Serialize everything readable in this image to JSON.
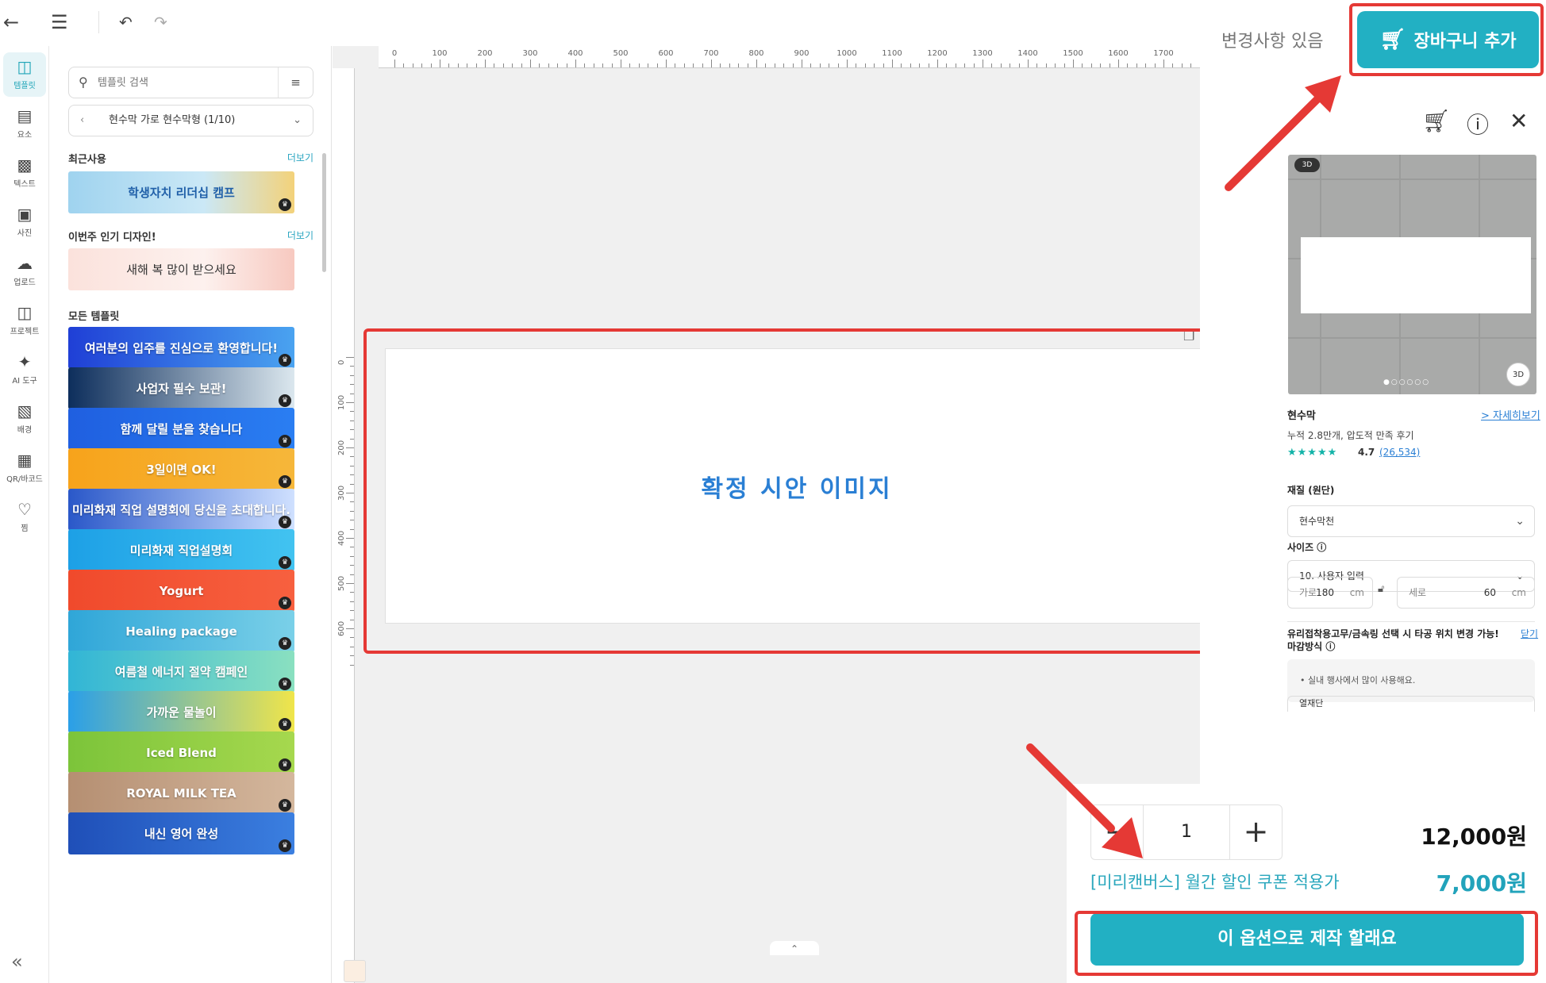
{
  "topbar": {
    "back_icon": "arrow-left-icon",
    "menu_icon": "menu-icon",
    "undo_icon": "undo-icon",
    "redo_icon": "redo-icon"
  },
  "rail": {
    "items": [
      {
        "label": "템플릿",
        "icon": "template-icon",
        "active": true
      },
      {
        "label": "요소",
        "icon": "shapes-icon"
      },
      {
        "label": "텍스트",
        "icon": "text-icon"
      },
      {
        "label": "사진",
        "icon": "photo-icon"
      },
      {
        "label": "업로드",
        "icon": "upload-cloud-icon"
      },
      {
        "label": "프로젝트",
        "icon": "archive-icon"
      },
      {
        "label": "AI 도구",
        "icon": "ai-sparkle-icon"
      },
      {
        "label": "배경",
        "icon": "pattern-icon"
      },
      {
        "label": "QR/바코드",
        "icon": "qr-icon"
      },
      {
        "label": "찜",
        "icon": "heart-icon"
      }
    ],
    "collapse_icon": "double-chevron-left-icon"
  },
  "panel": {
    "search_placeholder": "템플릿 검색",
    "category": "현수막 가로 현수막형 (1/10)",
    "recent_title": "최근사용",
    "popular_title": "이번주 인기 디자인!",
    "all_title": "모든 템플릿",
    "more_label": "더보기",
    "recent_template": "학생자치 리더십 캠프",
    "popular_template": "새해 복 많이 받으세요",
    "templates": [
      {
        "text": "여러분의 입주를 진심으로 환영합니다!",
        "bg": "linear-gradient(90deg,#1f3fd6,#4aa3f0)"
      },
      {
        "text": "사업자 필수 보관!",
        "bg": "linear-gradient(90deg,#0d2e5c,#dbe7ee)"
      },
      {
        "text": "함께 달릴 분을 찾습니다",
        "bg": "linear-gradient(90deg,#1f5fe0,#2a7ef2)"
      },
      {
        "text": "3일이면 OK!",
        "bg": "linear-gradient(90deg,#f7a31b,#f6b73a)"
      },
      {
        "text": "미리화재 직업 설명회에 당신을 초대합니다.",
        "bg": "linear-gradient(90deg,#2a58c9,#cfe0ff)"
      },
      {
        "text": "미리화재 직업설명회",
        "bg": "linear-gradient(90deg,#1da0e6,#42c3f0)"
      },
      {
        "text": "Yogurt",
        "bg": "linear-gradient(90deg,#f04a2c,#f7603f)"
      },
      {
        "text": "Healing package",
        "bg": "linear-gradient(90deg,#2fa6d8,#7ad0e8)"
      },
      {
        "text": "여름철 에너지 절약 캠페인",
        "bg": "linear-gradient(90deg,#31b5d6,#8ae0c0)"
      },
      {
        "text": "가까운 물놀이",
        "bg": "linear-gradient(90deg,#2a9fe8,#f0e54a)"
      },
      {
        "text": "Iced Blend",
        "bg": "linear-gradient(90deg,#7cc43a,#a6d84e)"
      },
      {
        "text": "ROYAL MILK TEA",
        "bg": "linear-gradient(90deg,#b58f72,#d4b79d)"
      },
      {
        "text": "내신 영어 완성",
        "bg": "linear-gradient(90deg,#1f4fb8,#3b7fe0)"
      }
    ]
  },
  "canvas": {
    "ruler_h": [
      "0",
      "100",
      "200",
      "300",
      "400",
      "500",
      "600",
      "700",
      "800",
      "900",
      "1000",
      "1100",
      "1200",
      "1300",
      "1400",
      "1500",
      "1600",
      "1700"
    ],
    "ruler_v": [
      "0",
      "100",
      "200",
      "300",
      "400",
      "500",
      "600"
    ],
    "preview_label": "확정 시안 이미지",
    "copy_icon": "copy-page-icon",
    "collapse_icon": "chevron-up-icon"
  },
  "right_header": {
    "changes_label": "변경사항 있음",
    "cart_button": "장바구니 추가",
    "cart_icon": "cart-icon"
  },
  "product": {
    "icons": [
      "cart-icon",
      "help-circle-icon",
      "close-icon"
    ],
    "badge_3d": "3D",
    "btn_3d": "3D",
    "name": "현수막",
    "detail_link": "> 자세히보기",
    "subtitle": "누적 2.8만개, 압도적 만족 후기",
    "stars": "★★★★★",
    "rating": "4.7",
    "reviews": "(26,534)",
    "material_label": "재질 (원단)",
    "material_value": "현수막천",
    "size_label": "사이즈 ⓘ",
    "size_value": "10. 사용자 입력",
    "width_label": "가로",
    "width_value": "180",
    "height_label": "세로",
    "height_value": "60",
    "unit": "cm",
    "notice": "유리접착용고무/금속링 선택 시 타공 위치 변경 가능!",
    "notice_close": "닫기",
    "finish_label": "마감방식 ⓘ",
    "finish_hint": "• 실내 행사에서 많이 사용해요.",
    "partial_select": "열재단"
  },
  "buy": {
    "quantity": "1",
    "minus": "−",
    "plus": "+",
    "price": "12,000원",
    "coupon_text": "[미리캔버스] 월간 할인 쿠폰 적용가",
    "coupon_price": "7,000원",
    "make_button": "이 옵션으로 제작 할래요"
  },
  "colors": {
    "accent": "#22b0c3",
    "annotation": "#e53935",
    "link": "#2a7fd4"
  }
}
